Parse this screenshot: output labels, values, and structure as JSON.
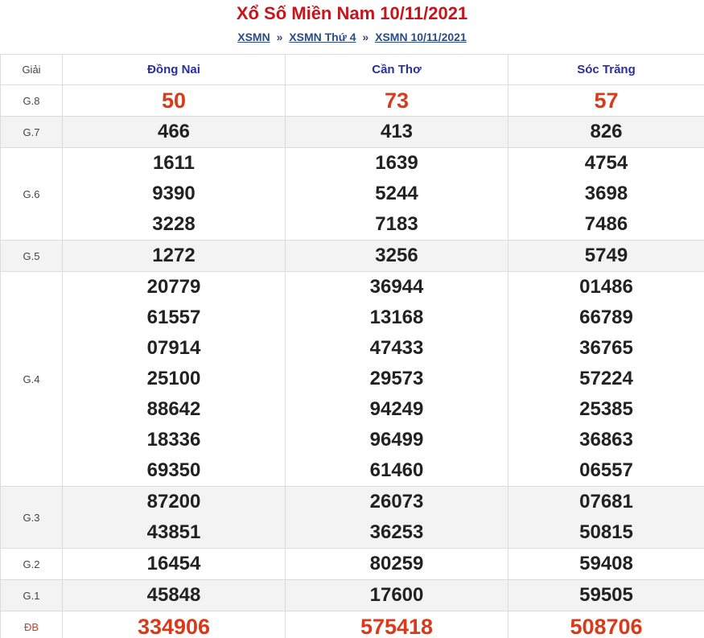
{
  "header": {
    "title": "Xổ Số Miền Nam 10/11/2021",
    "breadcrumb": [
      {
        "label": "XSMN"
      },
      {
        "label": "XSMN Thứ 4"
      },
      {
        "label": "XSMN 10/11/2021"
      }
    ],
    "separator": "»"
  },
  "table": {
    "prize_header": "Giải",
    "provinces": [
      "Đồng Nai",
      "Cần Thơ",
      "Sóc Trăng"
    ],
    "prizes": [
      {
        "label": "G.8",
        "values": [
          [
            "50"
          ],
          [
            "73"
          ],
          [
            "57"
          ]
        ]
      },
      {
        "label": "G.7",
        "values": [
          [
            "466"
          ],
          [
            "413"
          ],
          [
            "826"
          ]
        ]
      },
      {
        "label": "G.6",
        "values": [
          [
            "1611",
            "9390",
            "3228"
          ],
          [
            "1639",
            "5244",
            "7183"
          ],
          [
            "4754",
            "3698",
            "7486"
          ]
        ]
      },
      {
        "label": "G.5",
        "values": [
          [
            "1272"
          ],
          [
            "3256"
          ],
          [
            "5749"
          ]
        ]
      },
      {
        "label": "G.4",
        "values": [
          [
            "20779",
            "61557",
            "07914",
            "25100",
            "88642",
            "18336",
            "69350"
          ],
          [
            "36944",
            "13168",
            "47433",
            "29573",
            "94249",
            "96499",
            "61460"
          ],
          [
            "01486",
            "66789",
            "36765",
            "57224",
            "25385",
            "36863",
            "06557"
          ]
        ]
      },
      {
        "label": "G.3",
        "values": [
          [
            "87200",
            "43851"
          ],
          [
            "26073",
            "36253"
          ],
          [
            "07681",
            "50815"
          ]
        ]
      },
      {
        "label": "G.2",
        "values": [
          [
            "16454"
          ],
          [
            "80259"
          ],
          [
            "59408"
          ]
        ]
      },
      {
        "label": "G.1",
        "values": [
          [
            "45848"
          ],
          [
            "17600"
          ],
          [
            "59505"
          ]
        ]
      },
      {
        "label": "ĐB",
        "values": [
          [
            "334906"
          ],
          [
            "575418"
          ],
          [
            "508706"
          ]
        ]
      }
    ]
  },
  "colors": {
    "title": "#c4161c",
    "link": "#2b4b86",
    "province": "#2a2f9c",
    "highlight": "#d83a1a",
    "alt_row": "#f3f3f3"
  }
}
